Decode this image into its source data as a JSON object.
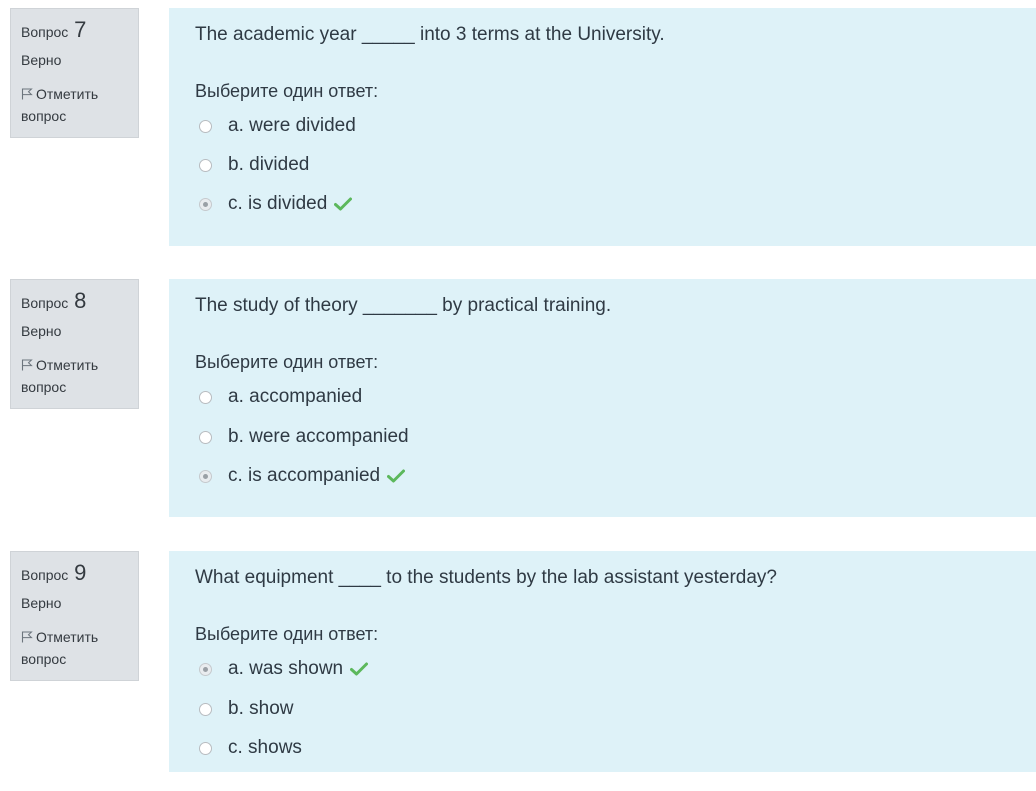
{
  "colors": {
    "info_bg": "#dee2e6",
    "content_bg": "#def2f8",
    "correct_green": "#5cb85c",
    "text": "#2f3a44"
  },
  "questions": [
    {
      "label": "Вопрос",
      "number": "7",
      "state": "Верно",
      "flag_label": "Отметить вопрос",
      "flag_icon": "flag-icon",
      "text": "The academic year _____ into 3 terms at the University.",
      "prompt": "Выберите один ответ:",
      "answers": [
        {
          "text": "a. were divided",
          "checked": false,
          "correct": false
        },
        {
          "text": "b. divided",
          "checked": false,
          "correct": false
        },
        {
          "text": "c. is divided",
          "checked": true,
          "correct": true
        }
      ]
    },
    {
      "label": "Вопрос",
      "number": "8",
      "state": "Верно",
      "flag_label": "Отметить вопрос",
      "flag_icon": "flag-icon",
      "text": "The study of theory _______ by practical training.",
      "prompt": "Выберите один ответ:",
      "answers": [
        {
          "text": "a. accompanied",
          "checked": false,
          "correct": false
        },
        {
          "text": "b. were accompanied",
          "checked": false,
          "correct": false
        },
        {
          "text": "c. is accompanied",
          "checked": true,
          "correct": true
        }
      ]
    },
    {
      "label": "Вопрос",
      "number": "9",
      "state": "Верно",
      "flag_label": "Отметить вопрос",
      "flag_icon": "flag-icon",
      "text": "What equipment ____ to the students by the lab assistant yesterday?",
      "prompt": "Выберите один ответ:",
      "answers": [
        {
          "text": "a. was shown",
          "checked": true,
          "correct": true
        },
        {
          "text": "b. show",
          "checked": false,
          "correct": false
        },
        {
          "text": "c. shows",
          "checked": false,
          "correct": false
        }
      ]
    }
  ]
}
